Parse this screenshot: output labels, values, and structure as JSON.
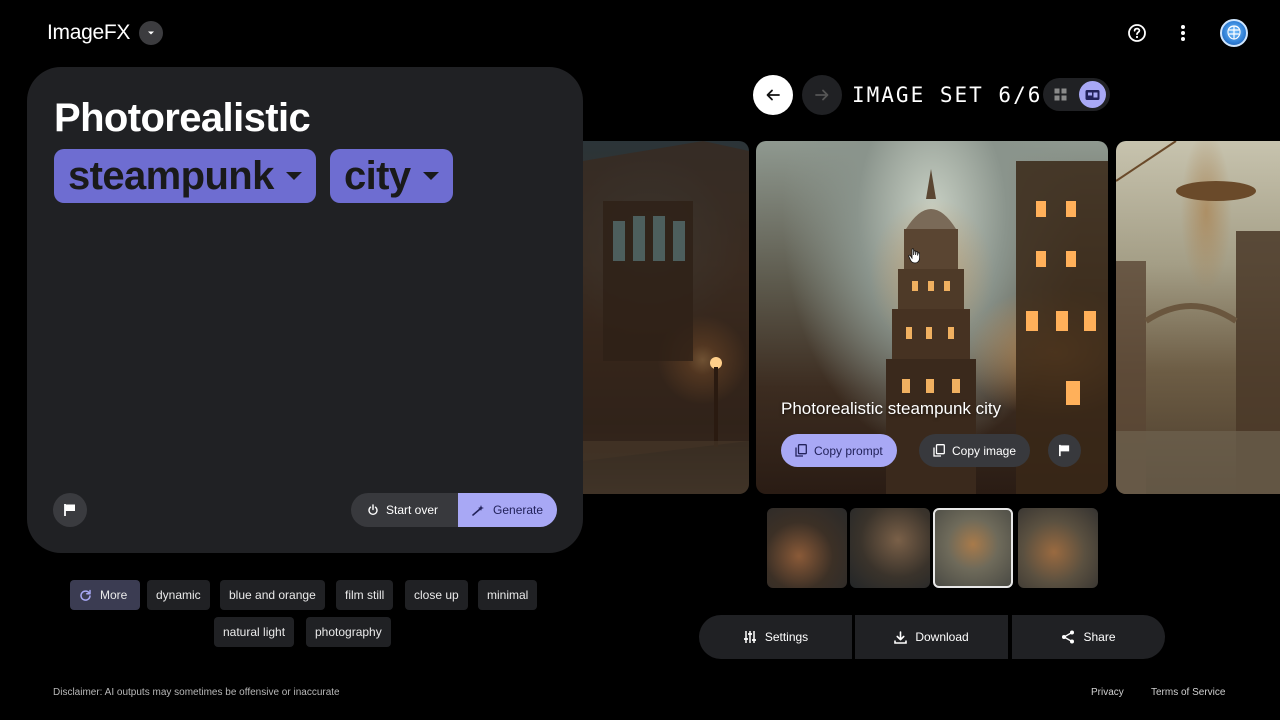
{
  "app": {
    "name": "ImageFX"
  },
  "header": {
    "icons": [
      "help-icon",
      "more-vert-icon",
      "account-avatar"
    ]
  },
  "prompt": {
    "text": "Photorealistic",
    "chips": [
      {
        "label": "steampunk"
      },
      {
        "label": "city"
      }
    ],
    "start_over_label": "Start over",
    "generate_label": "Generate"
  },
  "suggestions": {
    "more_label": "More",
    "chips": [
      "dynamic",
      "blue and orange",
      "film still",
      "close up",
      "minimal",
      "natural light",
      "photography"
    ]
  },
  "viewer": {
    "set_label": "IMAGE SET 6/6",
    "caption": "Photorealistic steampunk city",
    "copy_prompt_label": "Copy prompt",
    "copy_image_label": "Copy image",
    "thumbnails_count": 4,
    "selected_thumbnail": 3
  },
  "bottom_bar": {
    "settings_label": "Settings",
    "download_label": "Download",
    "share_label": "Share"
  },
  "footer": {
    "disclaimer": "Disclaimer: AI outputs may sometimes be offensive or inaccurate",
    "privacy": "Privacy",
    "terms": "Terms of Service"
  },
  "colors": {
    "accent": "#6e6dd1",
    "accent_light": "#a8a8f5",
    "panel": "#202124",
    "background": "#000000"
  }
}
